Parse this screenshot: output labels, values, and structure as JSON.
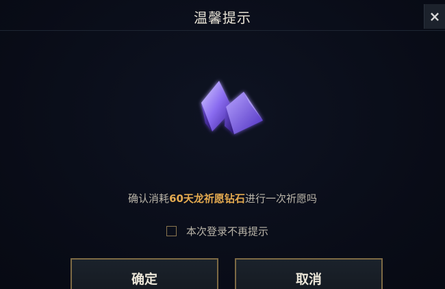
{
  "dialog": {
    "title": "温馨提示",
    "close_label": "×"
  },
  "message": {
    "prefix": "确认消耗",
    "highlight": "60天龙祈愿钻石",
    "suffix": "进行一次祈愿吗"
  },
  "checkbox": {
    "label": "本次登录不再提示",
    "checked": false
  },
  "buttons": {
    "confirm": "确定",
    "cancel": "取消"
  },
  "colors": {
    "highlight": "#e3a94f",
    "button_border": "#7d6a44",
    "background": "#090d18"
  },
  "icons": {
    "item": "purple-diamond-gem-icon"
  }
}
